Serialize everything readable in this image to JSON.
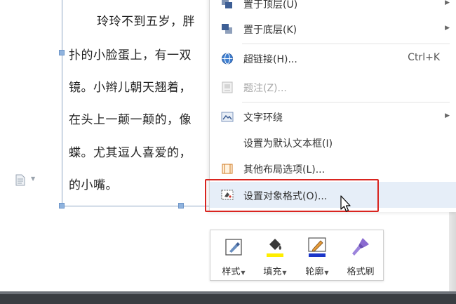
{
  "document": {
    "text_lines": [
      "玲玲不到五岁，胖",
      "扑的小脸蛋上，有一双",
      "镜。小辫儿朝天翘着，",
      "在头上一颠一颠的，像",
      "蝶。尤其逗人喜爱的，",
      "的小嘴。"
    ]
  },
  "context_menu": {
    "items": [
      {
        "label": "置于顶层(U)",
        "icon": "bring-to-front-icon",
        "submenu": true
      },
      {
        "label": "置于底层(K)",
        "icon": "send-to-back-icon",
        "submenu": true
      },
      {
        "label": "超链接(H)...",
        "icon": "hyperlink-icon",
        "shortcut": "Ctrl+K"
      },
      {
        "label": "题注(Z)...",
        "icon": "caption-icon",
        "disabled": true
      },
      {
        "label": "文字环绕",
        "icon": "text-wrap-icon",
        "submenu": true
      },
      {
        "label": "设置为默认文本框(I)"
      },
      {
        "label": "其他布局选项(L)...",
        "icon": "layout-options-icon"
      },
      {
        "label": "设置对象格式(O)...",
        "icon": "format-object-icon",
        "highlighted": true
      }
    ]
  },
  "mini_toolbar": {
    "buttons": [
      {
        "label": "样式",
        "icon": "style-icon",
        "dropdown": true
      },
      {
        "label": "填充",
        "icon": "fill-bucket-icon",
        "dropdown": true
      },
      {
        "label": "轮廓",
        "icon": "outline-pen-icon",
        "dropdown": true
      },
      {
        "label": "格式刷",
        "icon": "format-painter-icon",
        "dropdown": false
      }
    ]
  },
  "colors": {
    "highlight_border": "#d9241f",
    "hover_bg": "#e6eef8",
    "fill_accent": "#ffee00",
    "outline_accent": "#1a35c8",
    "painter_accent": "#8a6ad0"
  }
}
